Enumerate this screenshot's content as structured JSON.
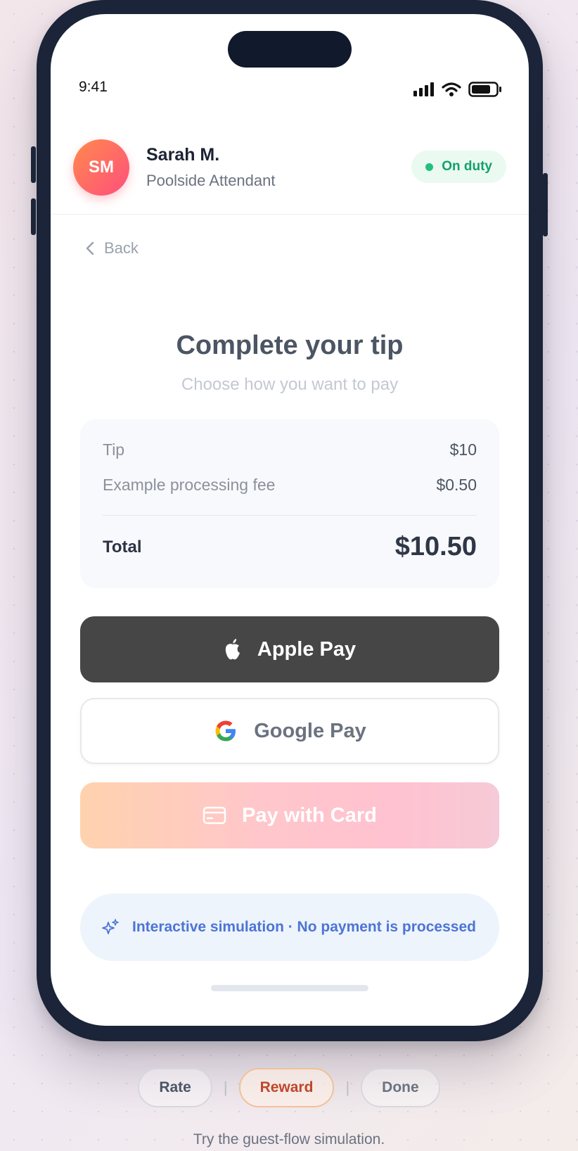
{
  "status_bar": {
    "time": "9:41"
  },
  "attendant": {
    "initials": "SM",
    "name": "Sarah M.",
    "role": "Poolside Attendant",
    "status": "On duty"
  },
  "nav": {
    "back_label": "Back"
  },
  "checkout": {
    "title": "Complete your tip",
    "subtitle": "Choose how you want to pay",
    "summary": {
      "tip_label": "Tip",
      "tip_value": "$10",
      "fee_label": "Example processing fee",
      "fee_value": "$0.50",
      "total_label": "Total",
      "total_value": "$10.50"
    },
    "payment_buttons": {
      "apple_pay": "Apple Pay",
      "google_pay": "Google Pay",
      "card": "Pay with Card"
    },
    "notice": "Interactive simulation · No payment is processed"
  },
  "flow_steps": {
    "rate": "Rate",
    "reward": "Reward",
    "done": "Done",
    "separator": "|",
    "active_step": "Reward"
  },
  "caption": "Try the guest-flow simulation.",
  "colors": {
    "status_green": "#14a06a",
    "apple_button": "#464646",
    "notice_text": "#4d74d6",
    "active_step": "#c0462b"
  }
}
